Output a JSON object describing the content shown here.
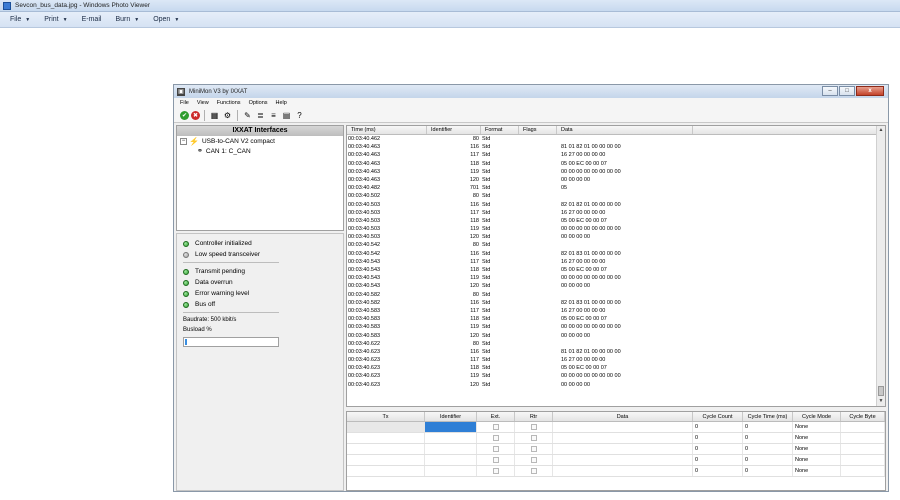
{
  "photo_viewer": {
    "title": "Sevcon_bus_data.jpg - Windows Photo Viewer",
    "menu": [
      {
        "label": "File",
        "has_arrow": true
      },
      {
        "label": "Print",
        "has_arrow": true
      },
      {
        "label": "E-mail",
        "has_arrow": false
      },
      {
        "label": "Burn",
        "has_arrow": true
      },
      {
        "label": "Open",
        "has_arrow": true
      }
    ]
  },
  "minimon": {
    "title": "MiniMon V3 by IXXAT",
    "window_buttons": {
      "minimize": "–",
      "maximize": "□",
      "close": "x"
    },
    "menu": [
      "File",
      "View",
      "Functions",
      "Options",
      "Help"
    ],
    "toolbar_icons": [
      "start-icon",
      "stop-icon",
      "grid-icon",
      "settings-gear-icon",
      "eraser-icon",
      "log-icon",
      "trace-icon",
      "window-icon",
      "help-icon"
    ],
    "interfaces": {
      "header": "IXXAT Interfaces",
      "device": "USB-to-CAN V2 compact",
      "channel": "CAN 1: C_CAN"
    },
    "status": {
      "items": [
        {
          "label": "Controller initialized",
          "on": true
        },
        {
          "label": "Low speed transceiver",
          "on": false
        },
        {
          "label": "Transmit pending",
          "on": true
        },
        {
          "label": "Data overrun",
          "on": true
        },
        {
          "label": "Error warning level",
          "on": true
        },
        {
          "label": "Bus off",
          "on": true
        }
      ],
      "baudrate": "Baudrate: 500 kbit/s",
      "busload_label": "Busload %",
      "busload_value": 0.02
    },
    "messages": {
      "columns": [
        "Time (ms)",
        "Identifier",
        "Format",
        "Flags",
        "Data"
      ],
      "rows": [
        {
          "time": "00:03:40.462",
          "id": "80",
          "fmt": "Std",
          "data": ""
        },
        {
          "time": "00:03:40.463",
          "id": "116",
          "fmt": "Std",
          "data": "81 01 82 01 00 00 00 00"
        },
        {
          "time": "00:03:40.463",
          "id": "117",
          "fmt": "Std",
          "data": "16 27 00 00 00 00"
        },
        {
          "time": "00:03:40.463",
          "id": "118",
          "fmt": "Std",
          "data": "05 00 EC 00 00 07"
        },
        {
          "time": "00:03:40.463",
          "id": "119",
          "fmt": "Std",
          "data": "00 00 00 00 00 00 00 00"
        },
        {
          "time": "00:03:40.463",
          "id": "120",
          "fmt": "Std",
          "data": "00 00 00 00"
        },
        {
          "time": "00:03:40.482",
          "id": "701",
          "fmt": "Std",
          "data": "05"
        },
        {
          "time": "00:03:40.502",
          "id": "80",
          "fmt": "Std",
          "data": ""
        },
        {
          "time": "00:03:40.503",
          "id": "116",
          "fmt": "Std",
          "data": "82 01 82 01 00 00 00 00"
        },
        {
          "time": "00:03:40.503",
          "id": "117",
          "fmt": "Std",
          "data": "16 27 00 00 00 00"
        },
        {
          "time": "00:03:40.503",
          "id": "118",
          "fmt": "Std",
          "data": "05 00 EC 00 00 07"
        },
        {
          "time": "00:03:40.503",
          "id": "119",
          "fmt": "Std",
          "data": "00 00 00 00 00 00 00 00"
        },
        {
          "time": "00:03:40.503",
          "id": "120",
          "fmt": "Std",
          "data": "00 00 00 00"
        },
        {
          "time": "00:03:40.542",
          "id": "80",
          "fmt": "Std",
          "data": ""
        },
        {
          "time": "00:03:40.542",
          "id": "116",
          "fmt": "Std",
          "data": "82 01 83 01 00 00 00 00"
        },
        {
          "time": "00:03:40.543",
          "id": "117",
          "fmt": "Std",
          "data": "16 27 00 00 00 00"
        },
        {
          "time": "00:03:40.543",
          "id": "118",
          "fmt": "Std",
          "data": "05 00 EC 00 00 07"
        },
        {
          "time": "00:03:40.543",
          "id": "119",
          "fmt": "Std",
          "data": "00 00 00 00 00 00 00 00"
        },
        {
          "time": "00:03:40.543",
          "id": "120",
          "fmt": "Std",
          "data": "00 00 00 00"
        },
        {
          "time": "00:03:40.582",
          "id": "80",
          "fmt": "Std",
          "data": ""
        },
        {
          "time": "00:03:40.582",
          "id": "116",
          "fmt": "Std",
          "data": "82 01 83 01 00 00 00 00"
        },
        {
          "time": "00:03:40.583",
          "id": "117",
          "fmt": "Std",
          "data": "16 27 00 00 00 00"
        },
        {
          "time": "00:03:40.583",
          "id": "118",
          "fmt": "Std",
          "data": "05 00 EC 00 00 07"
        },
        {
          "time": "00:03:40.583",
          "id": "119",
          "fmt": "Std",
          "data": "00 00 00 00 00 00 00 00"
        },
        {
          "time": "00:03:40.583",
          "id": "120",
          "fmt": "Std",
          "data": "00 00 00 00"
        },
        {
          "time": "00:03:40.622",
          "id": "80",
          "fmt": "Std",
          "data": ""
        },
        {
          "time": "00:03:40.623",
          "id": "116",
          "fmt": "Std",
          "data": "81 01 82 01 00 00 00 00"
        },
        {
          "time": "00:03:40.623",
          "id": "117",
          "fmt": "Std",
          "data": "16 27 00 00 00 00"
        },
        {
          "time": "00:03:40.623",
          "id": "118",
          "fmt": "Std",
          "data": "05 00 EC 00 00 07"
        },
        {
          "time": "00:03:40.623",
          "id": "119",
          "fmt": "Std",
          "data": "00 00 00 00 00 00 00 00"
        },
        {
          "time": "00:03:40.623",
          "id": "120",
          "fmt": "Std",
          "data": "00 00 00 00"
        }
      ]
    },
    "transmit": {
      "columns": [
        "Tx",
        "Identifier",
        "Ext.",
        "Rtr",
        "Data",
        "Cycle Count",
        "Cycle Time (ms)",
        "Cycle Mode",
        "Cycle Byte"
      ],
      "rows": [
        {
          "cycle_count": "0",
          "cycle_time": "0",
          "cycle_mode": "None"
        },
        {
          "cycle_count": "0",
          "cycle_time": "0",
          "cycle_mode": "None"
        },
        {
          "cycle_count": "0",
          "cycle_time": "0",
          "cycle_mode": "None"
        },
        {
          "cycle_count": "0",
          "cycle_time": "0",
          "cycle_mode": "None"
        },
        {
          "cycle_count": "0",
          "cycle_time": "0",
          "cycle_mode": "None"
        }
      ]
    }
  }
}
